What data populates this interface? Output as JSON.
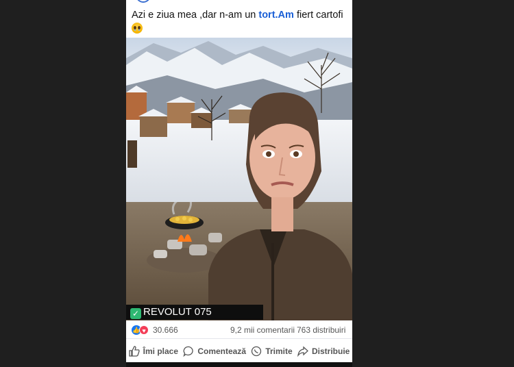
{
  "post": {
    "caption_part1": "Azi e ziua mea ,dar n-am  un ",
    "caption_highlight": "tort.Am",
    "caption_part2": " fiert cartofi",
    "caption_emoji": "pleading-face-icon"
  },
  "photo_overlay": {
    "text": "REVOLUT 075"
  },
  "stats": {
    "reaction_count": "30.666",
    "comments": "9,2 mii comentarii",
    "shares": "763 distribuiri"
  },
  "actions": {
    "like": "Îmi place",
    "comment": "Comentează",
    "send": "Trimite",
    "share": "Distribuie"
  },
  "colors": {
    "link_blue": "#1a5fd6",
    "like_blue": "#1877f2",
    "love_red": "#f33e58",
    "background": "#1f1f1f"
  }
}
